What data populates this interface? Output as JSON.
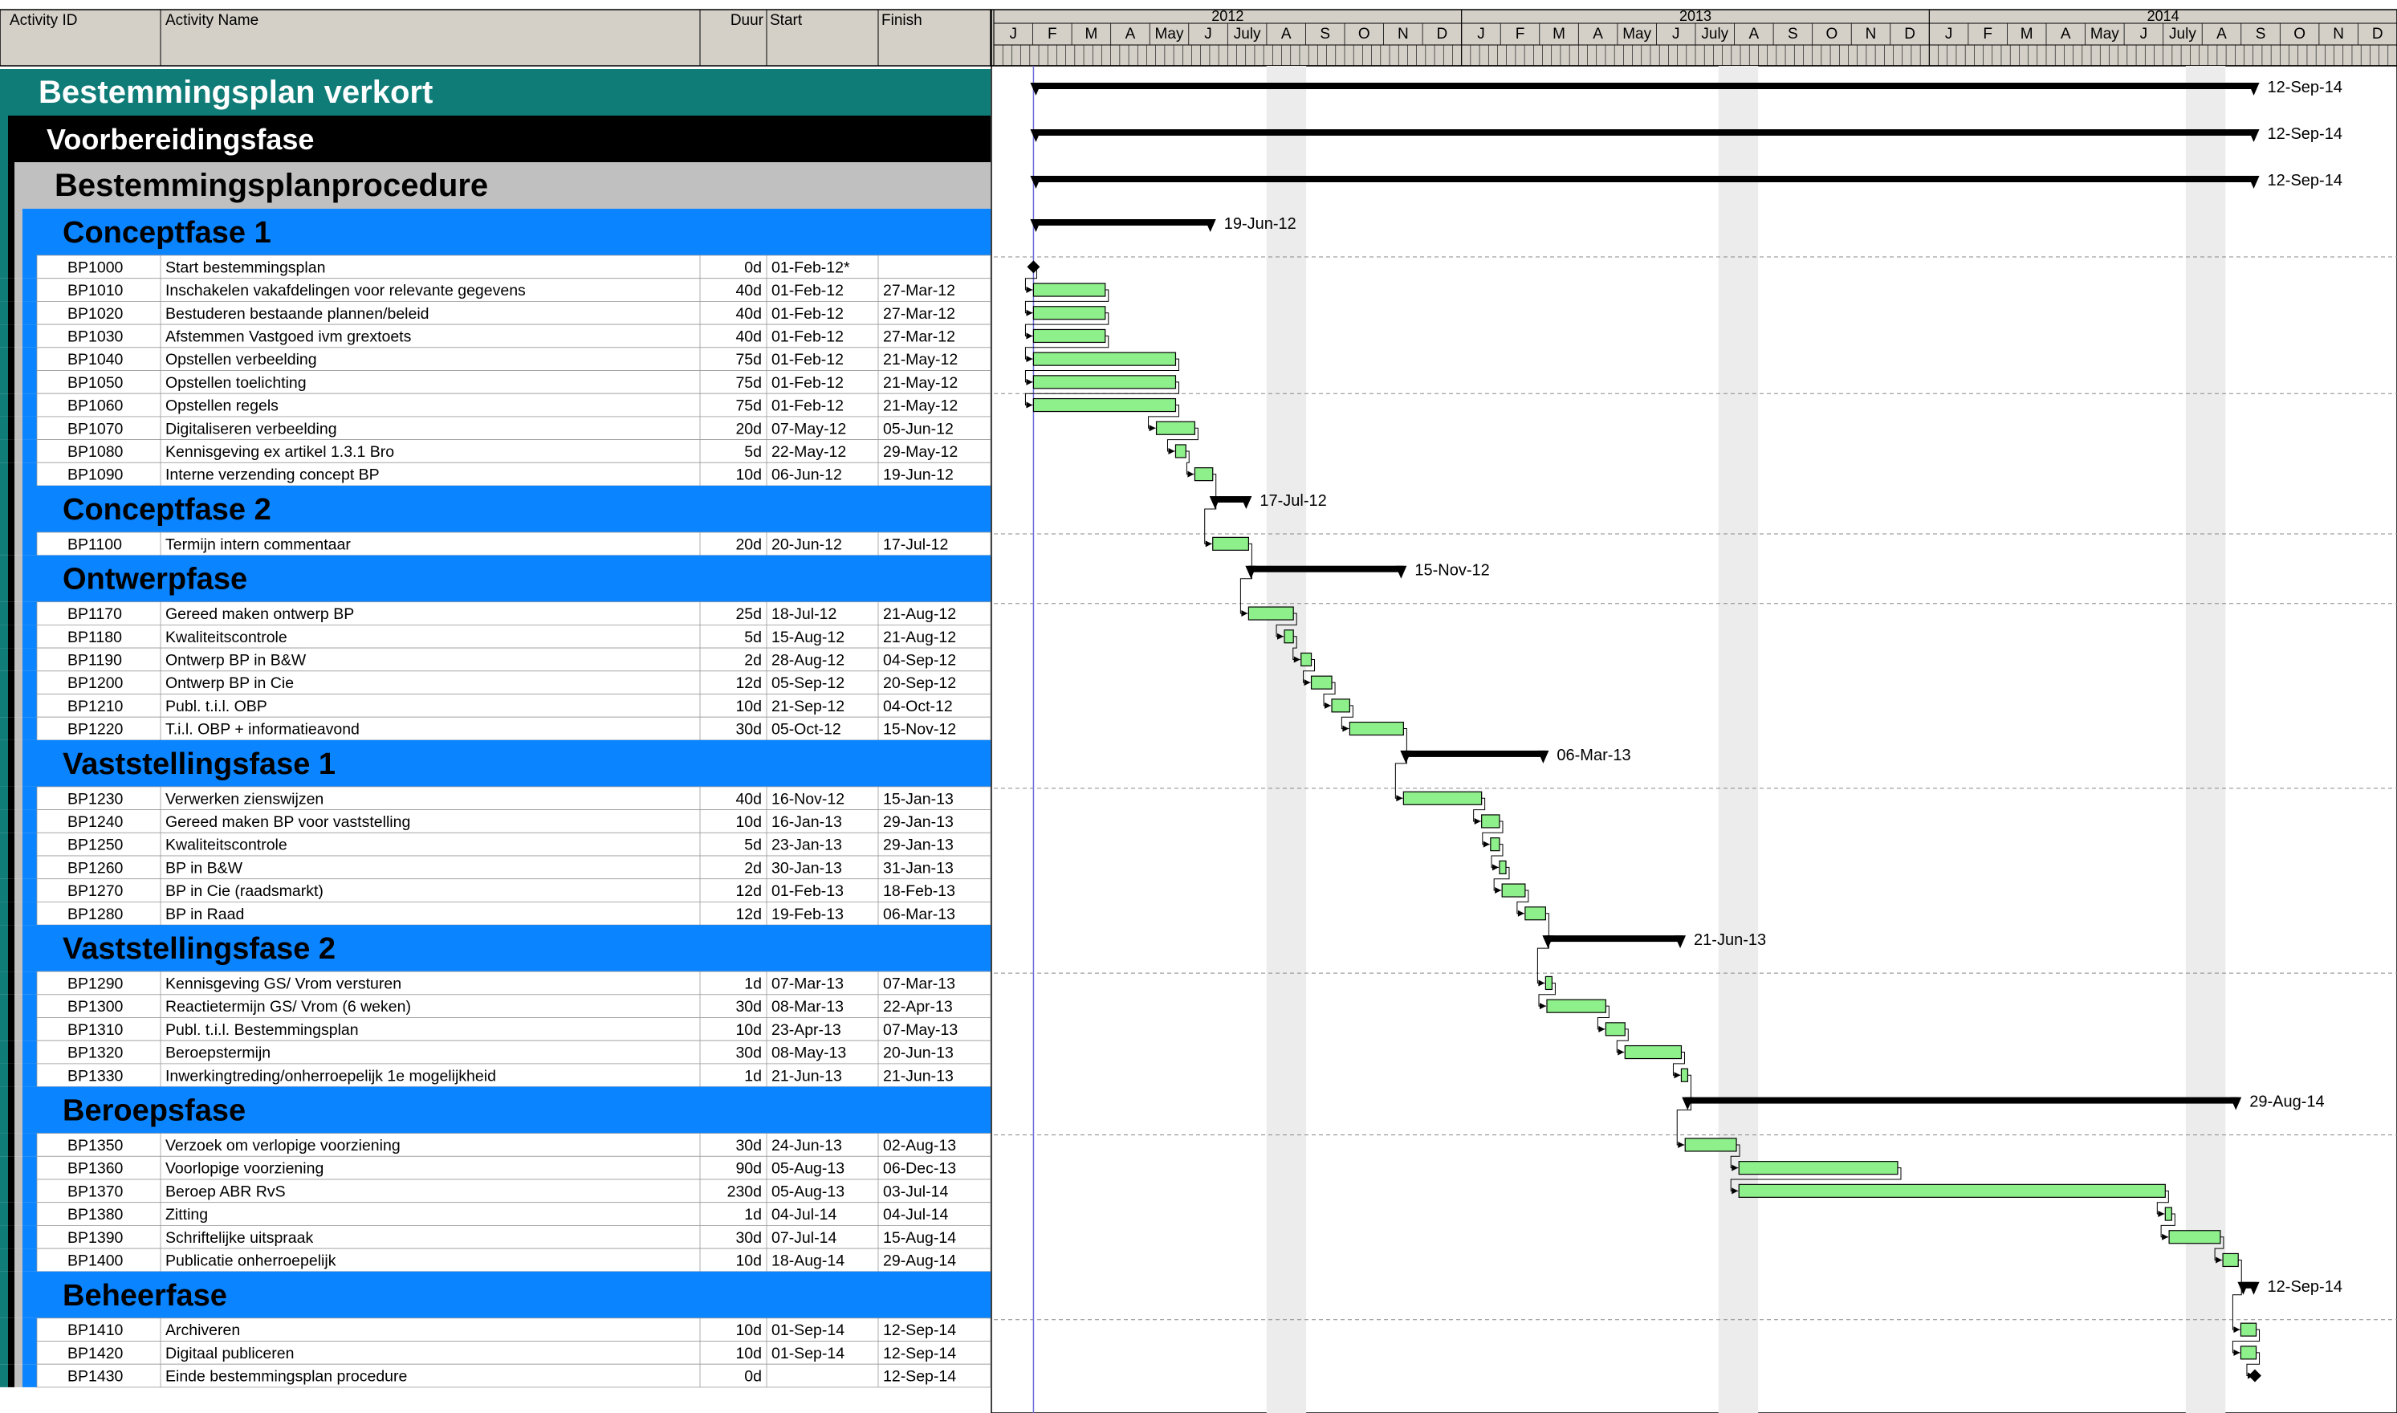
{
  "columns": {
    "activity_id": "Activity ID",
    "activity_name": "Activity Name",
    "duration": "Duur",
    "start": "Start",
    "finish": "Finish"
  },
  "timescale": {
    "years": [
      "2012",
      "2013",
      "2014"
    ],
    "months": [
      "J",
      "F",
      "M",
      "A",
      "May",
      "J",
      "July",
      "A",
      "S",
      "O",
      "N",
      "D"
    ]
  },
  "colors": {
    "header_bg": "#d4d0c8",
    "project_band": "#107c78",
    "phase_band": "#000000",
    "procedure_band": "#c0c0c0",
    "wbs_band": "#0a84ff",
    "task_bar": "#8ef08a",
    "summary_bar": "#000000",
    "data_date_line": "#6a6ad8"
  },
  "rows": [
    {
      "type": "wbs0",
      "name": "Bestemmingsplan verkort",
      "summary": {
        "start": "2012-02-01",
        "finish": "2014-09-12",
        "label": "12-Sep-14"
      }
    },
    {
      "type": "wbs1",
      "name": "Voorbereidingsfase",
      "summary": {
        "start": "2012-02-01",
        "finish": "2014-09-12",
        "label": "12-Sep-14"
      }
    },
    {
      "type": "wbs2",
      "name": "Bestemmingsplanprocedure",
      "summary": {
        "start": "2012-02-01",
        "finish": "2014-09-12",
        "label": "12-Sep-14"
      }
    },
    {
      "type": "wbs3",
      "name": "Conceptfase 1",
      "summary": {
        "start": "2012-02-01",
        "finish": "2012-06-19",
        "label": "19-Jun-12"
      }
    },
    {
      "type": "task",
      "id": "BP1000",
      "name": "Start bestemmingsplan",
      "dur": "0d",
      "start": "01-Feb-12*",
      "finish": "",
      "bar": {
        "s": "2012-02-01",
        "f": "2012-02-01",
        "milestone": true
      }
    },
    {
      "type": "task",
      "id": "BP1010",
      "name": "Inschakelen vakafdelingen voor relevante gegevens",
      "dur": "40d",
      "start": "01-Feb-12",
      "finish": "27-Mar-12",
      "bar": {
        "s": "2012-02-01",
        "f": "2012-03-27"
      }
    },
    {
      "type": "task",
      "id": "BP1020",
      "name": "Bestuderen bestaande plannen/beleid",
      "dur": "40d",
      "start": "01-Feb-12",
      "finish": "27-Mar-12",
      "bar": {
        "s": "2012-02-01",
        "f": "2012-03-27"
      }
    },
    {
      "type": "task",
      "id": "BP1030",
      "name": "Afstemmen Vastgoed ivm grextoets",
      "dur": "40d",
      "start": "01-Feb-12",
      "finish": "27-Mar-12",
      "bar": {
        "s": "2012-02-01",
        "f": "2012-03-27"
      }
    },
    {
      "type": "task",
      "id": "BP1040",
      "name": "Opstellen verbeelding",
      "dur": "75d",
      "start": "01-Feb-12",
      "finish": "21-May-12",
      "bar": {
        "s": "2012-02-01",
        "f": "2012-05-21"
      }
    },
    {
      "type": "task",
      "id": "BP1050",
      "name": "Opstellen toelichting",
      "dur": "75d",
      "start": "01-Feb-12",
      "finish": "21-May-12",
      "bar": {
        "s": "2012-02-01",
        "f": "2012-05-21"
      }
    },
    {
      "type": "task",
      "id": "BP1060",
      "name": "Opstellen regels",
      "dur": "75d",
      "start": "01-Feb-12",
      "finish": "21-May-12",
      "bar": {
        "s": "2012-02-01",
        "f": "2012-05-21"
      }
    },
    {
      "type": "task",
      "id": "BP1070",
      "name": "Digitaliseren verbeelding",
      "dur": "20d",
      "start": "07-May-12",
      "finish": "05-Jun-12",
      "bar": {
        "s": "2012-05-07",
        "f": "2012-06-05"
      }
    },
    {
      "type": "task",
      "id": "BP1080",
      "name": "Kennisgeving ex artikel 1.3.1 Bro",
      "dur": "5d",
      "start": "22-May-12",
      "finish": "29-May-12",
      "bar": {
        "s": "2012-05-22",
        "f": "2012-05-29"
      }
    },
    {
      "type": "task",
      "id": "BP1090",
      "name": "Interne verzending concept BP",
      "dur": "10d",
      "start": "06-Jun-12",
      "finish": "19-Jun-12",
      "bar": {
        "s": "2012-06-06",
        "f": "2012-06-19"
      }
    },
    {
      "type": "wbs3",
      "name": "Conceptfase 2",
      "summary": {
        "start": "2012-06-20",
        "finish": "2012-07-17",
        "label": "17-Jul-12"
      }
    },
    {
      "type": "task",
      "id": "BP1100",
      "name": "Termijn intern commentaar",
      "dur": "20d",
      "start": "20-Jun-12",
      "finish": "17-Jul-12",
      "bar": {
        "s": "2012-06-20",
        "f": "2012-07-17"
      }
    },
    {
      "type": "wbs3",
      "name": "Ontwerpfase",
      "summary": {
        "start": "2012-07-18",
        "finish": "2012-11-15",
        "label": "15-Nov-12"
      }
    },
    {
      "type": "task",
      "id": "BP1170",
      "name": "Gereed maken ontwerp BP",
      "dur": "25d",
      "start": "18-Jul-12",
      "finish": "21-Aug-12",
      "bar": {
        "s": "2012-07-18",
        "f": "2012-08-21"
      }
    },
    {
      "type": "task",
      "id": "BP1180",
      "name": "Kwaliteitscontrole",
      "dur": "5d",
      "start": "15-Aug-12",
      "finish": "21-Aug-12",
      "bar": {
        "s": "2012-08-15",
        "f": "2012-08-21"
      }
    },
    {
      "type": "task",
      "id": "BP1190",
      "name": "Ontwerp BP in B&W",
      "dur": "2d",
      "start": "28-Aug-12",
      "finish": "04-Sep-12",
      "bar": {
        "s": "2012-08-28",
        "f": "2012-09-04"
      }
    },
    {
      "type": "task",
      "id": "BP1200",
      "name": "Ontwerp BP in Cie",
      "dur": "12d",
      "start": "05-Sep-12",
      "finish": "20-Sep-12",
      "bar": {
        "s": "2012-09-05",
        "f": "2012-09-20"
      }
    },
    {
      "type": "task",
      "id": "BP1210",
      "name": "Publ. t.i.l. OBP",
      "dur": "10d",
      "start": "21-Sep-12",
      "finish": "04-Oct-12",
      "bar": {
        "s": "2012-09-21",
        "f": "2012-10-04"
      }
    },
    {
      "type": "task",
      "id": "BP1220",
      "name": "T.i.l. OBP +  informatieavond",
      "dur": "30d",
      "start": "05-Oct-12",
      "finish": "15-Nov-12",
      "bar": {
        "s": "2012-10-05",
        "f": "2012-11-15"
      }
    },
    {
      "type": "wbs3",
      "name": "Vaststellingsfase 1",
      "summary": {
        "start": "2012-11-16",
        "finish": "2013-03-06",
        "label": "06-Mar-13"
      }
    },
    {
      "type": "task",
      "id": "BP1230",
      "name": "Verwerken zienswijzen",
      "dur": "40d",
      "start": "16-Nov-12",
      "finish": "15-Jan-13",
      "bar": {
        "s": "2012-11-16",
        "f": "2013-01-15"
      }
    },
    {
      "type": "task",
      "id": "BP1240",
      "name": "Gereed maken BP voor vaststelling",
      "dur": "10d",
      "start": "16-Jan-13",
      "finish": "29-Jan-13",
      "bar": {
        "s": "2013-01-16",
        "f": "2013-01-29"
      }
    },
    {
      "type": "task",
      "id": "BP1250",
      "name": "Kwaliteitscontrole",
      "dur": "5d",
      "start": "23-Jan-13",
      "finish": "29-Jan-13",
      "bar": {
        "s": "2013-01-23",
        "f": "2013-01-29"
      }
    },
    {
      "type": "task",
      "id": "BP1260",
      "name": "BP in B&W",
      "dur": "2d",
      "start": "30-Jan-13",
      "finish": "31-Jan-13",
      "bar": {
        "s": "2013-01-30",
        "f": "2013-01-31"
      }
    },
    {
      "type": "task",
      "id": "BP1270",
      "name": "BP in Cie (raadsmarkt)",
      "dur": "12d",
      "start": "01-Feb-13",
      "finish": "18-Feb-13",
      "bar": {
        "s": "2013-02-01",
        "f": "2013-02-18"
      }
    },
    {
      "type": "task",
      "id": "BP1280",
      "name": "BP in Raad",
      "dur": "12d",
      "start": "19-Feb-13",
      "finish": "06-Mar-13",
      "bar": {
        "s": "2013-02-19",
        "f": "2013-03-06"
      }
    },
    {
      "type": "wbs3",
      "name": "Vaststellingsfase 2",
      "summary": {
        "start": "2013-03-07",
        "finish": "2013-06-21",
        "label": "21-Jun-13"
      }
    },
    {
      "type": "task",
      "id": "BP1290",
      "name": "Kennisgeving GS/ Vrom versturen",
      "dur": "1d",
      "start": "07-Mar-13",
      "finish": "07-Mar-13",
      "bar": {
        "s": "2013-03-07",
        "f": "2013-03-07"
      }
    },
    {
      "type": "task",
      "id": "BP1300",
      "name": "Reactietermijn GS/ Vrom (6 weken)",
      "dur": "30d",
      "start": "08-Mar-13",
      "finish": "22-Apr-13",
      "bar": {
        "s": "2013-03-08",
        "f": "2013-04-22"
      }
    },
    {
      "type": "task",
      "id": "BP1310",
      "name": "Publ. t.i.l. Bestemmingsplan",
      "dur": "10d",
      "start": "23-Apr-13",
      "finish": "07-May-13",
      "bar": {
        "s": "2013-04-23",
        "f": "2013-05-07"
      }
    },
    {
      "type": "task",
      "id": "BP1320",
      "name": "Beroepstermijn",
      "dur": "30d",
      "start": "08-May-13",
      "finish": "20-Jun-13",
      "bar": {
        "s": "2013-05-08",
        "f": "2013-06-20"
      }
    },
    {
      "type": "task",
      "id": "BP1330",
      "name": "Inwerkingtreding/onherroepelijk 1e mogelijkheid",
      "dur": "1d",
      "start": "21-Jun-13",
      "finish": "21-Jun-13",
      "bar": {
        "s": "2013-06-21",
        "f": "2013-06-21"
      }
    },
    {
      "type": "wbs3",
      "name": "Beroepsfase",
      "summary": {
        "start": "2013-06-24",
        "finish": "2014-08-29",
        "label": "29-Aug-14"
      }
    },
    {
      "type": "task",
      "id": "BP1350",
      "name": "Verzoek om verlopige voorziening",
      "dur": "30d",
      "start": "24-Jun-13",
      "finish": "02-Aug-13",
      "bar": {
        "s": "2013-06-24",
        "f": "2013-08-02"
      }
    },
    {
      "type": "task",
      "id": "BP1360",
      "name": "Voorlopige voorziening",
      "dur": "90d",
      "start": "05-Aug-13",
      "finish": "06-Dec-13",
      "bar": {
        "s": "2013-08-05",
        "f": "2013-12-06"
      }
    },
    {
      "type": "task",
      "id": "BP1370",
      "name": "Beroep ABR RvS",
      "dur": "230d",
      "start": "05-Aug-13",
      "finish": "03-Jul-14",
      "bar": {
        "s": "2013-08-05",
        "f": "2014-07-03"
      }
    },
    {
      "type": "task",
      "id": "BP1380",
      "name": "Zitting",
      "dur": "1d",
      "start": "04-Jul-14",
      "finish": "04-Jul-14",
      "bar": {
        "s": "2014-07-04",
        "f": "2014-07-04"
      }
    },
    {
      "type": "task",
      "id": "BP1390",
      "name": "Schriftelijke uitspraak",
      "dur": "30d",
      "start": "07-Jul-14",
      "finish": "15-Aug-14",
      "bar": {
        "s": "2014-07-07",
        "f": "2014-08-15"
      }
    },
    {
      "type": "task",
      "id": "BP1400",
      "name": "Publicatie onherroepelijk",
      "dur": "10d",
      "start": "18-Aug-14",
      "finish": "29-Aug-14",
      "bar": {
        "s": "2014-08-18",
        "f": "2014-08-29"
      }
    },
    {
      "type": "wbs3",
      "name": "Beheerfase",
      "summary": {
        "start": "2014-09-01",
        "finish": "2014-09-12",
        "label": "12-Sep-14"
      }
    },
    {
      "type": "task",
      "id": "BP1410",
      "name": "Archiveren",
      "dur": "10d",
      "start": "01-Sep-14",
      "finish": "12-Sep-14",
      "bar": {
        "s": "2014-09-01",
        "f": "2014-09-12"
      }
    },
    {
      "type": "task",
      "id": "BP1420",
      "name": "Digitaal publiceren",
      "dur": "10d",
      "start": "01-Sep-14",
      "finish": "12-Sep-14",
      "bar": {
        "s": "2014-09-01",
        "f": "2014-09-12"
      }
    },
    {
      "type": "task",
      "id": "BP1430",
      "name": "Einde bestemmingsplan procedure",
      "dur": "0d",
      "start": "",
      "finish": "12-Sep-14",
      "bar": {
        "s": "2014-09-12",
        "f": "2014-09-12",
        "milestone": true
      }
    }
  ]
}
